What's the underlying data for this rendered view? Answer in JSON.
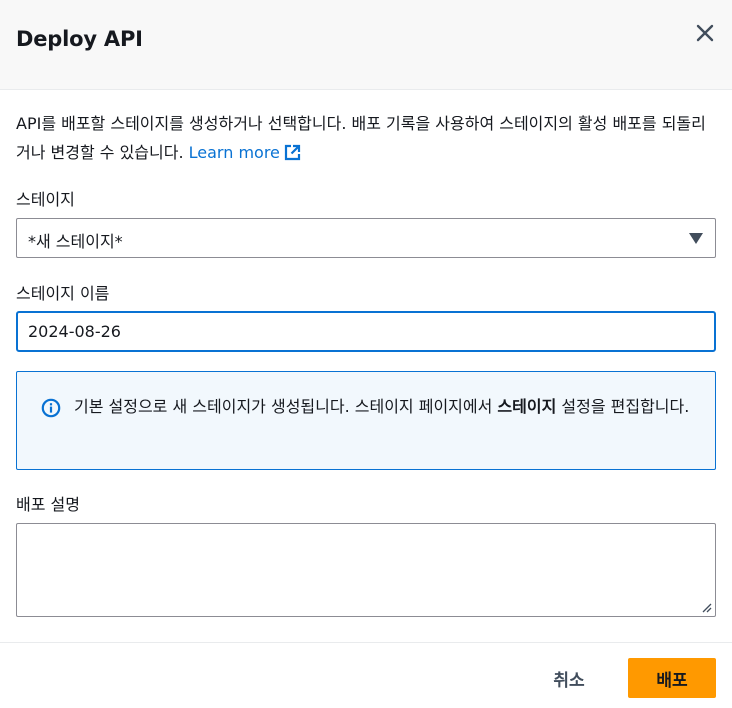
{
  "dialog": {
    "title": "Deploy API",
    "close_icon": "close-icon"
  },
  "intro": {
    "text": "API를 배포할 스테이지를 생성하거나 선택합니다. 배포 기록을 사용하여 스테이지의 활성 배포를 되돌리거나 변경할 수 있습니다. ",
    "link_label": "Learn more",
    "link_icon": "external-link-icon"
  },
  "stage": {
    "label": "스테이지",
    "selected": "*새 스테이지*",
    "caret_icon": "caret-down-icon"
  },
  "stage_name": {
    "label": "스테이지 이름",
    "value": "2024-08-26"
  },
  "info": {
    "icon": "info-icon",
    "text_before": "기본 설정으로 새 스테이지가 생성됩니다. 스테이지 페이지에서 ",
    "text_bold": "스테이지",
    "text_after": " 설정을 편집합니다."
  },
  "description": {
    "label": "배포 설명",
    "value": ""
  },
  "footer": {
    "cancel_label": "취소",
    "deploy_label": "배포"
  },
  "colors": {
    "primary_button": "#ff9900",
    "link": "#0972d3",
    "info_bg": "#f2f8fd",
    "header_bg": "#f8f8f8"
  }
}
